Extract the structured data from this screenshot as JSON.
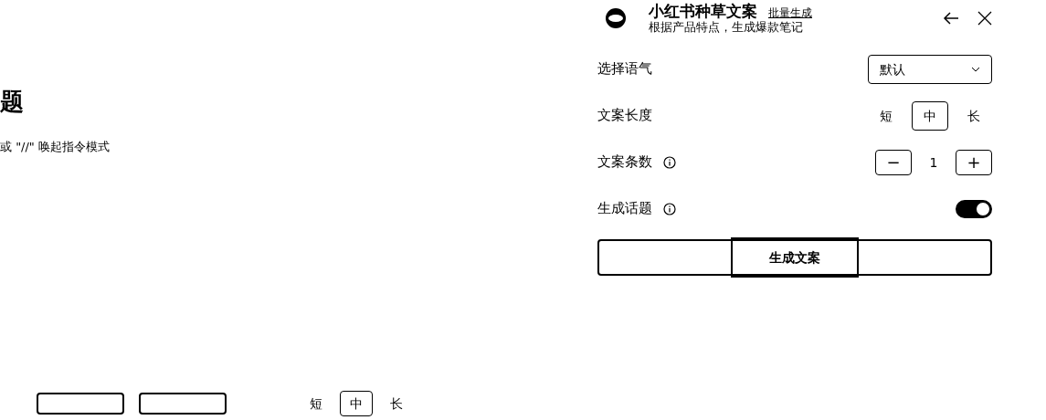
{
  "editor": {
    "heading": "题",
    "hint": "或 \"//\" 唤起指令模式",
    "bottom_bar": {
      "length_options": [
        {
          "label": "短",
          "selected": false
        },
        {
          "label": "中",
          "selected": true
        },
        {
          "label": "长",
          "selected": false
        }
      ]
    }
  },
  "panel": {
    "title": "小红书种草文案",
    "batch_link": "批量生成",
    "subtitle": "根据产品特点，生成爆款笔记",
    "rows": [
      {
        "kind": "select",
        "label": "选择语气",
        "value": "默认"
      },
      {
        "kind": "segments",
        "label": "文案长度",
        "options": [
          {
            "label": "短",
            "selected": false
          },
          {
            "label": "中",
            "selected": true
          },
          {
            "label": "长",
            "selected": false
          }
        ]
      },
      {
        "kind": "stepper",
        "label": "文案条数",
        "info": true,
        "value": "1",
        "minus": "−",
        "plus": "+"
      },
      {
        "kind": "toggle",
        "label": "生成话题",
        "info": true,
        "on": true
      }
    ],
    "generate_button": "生成文案"
  }
}
